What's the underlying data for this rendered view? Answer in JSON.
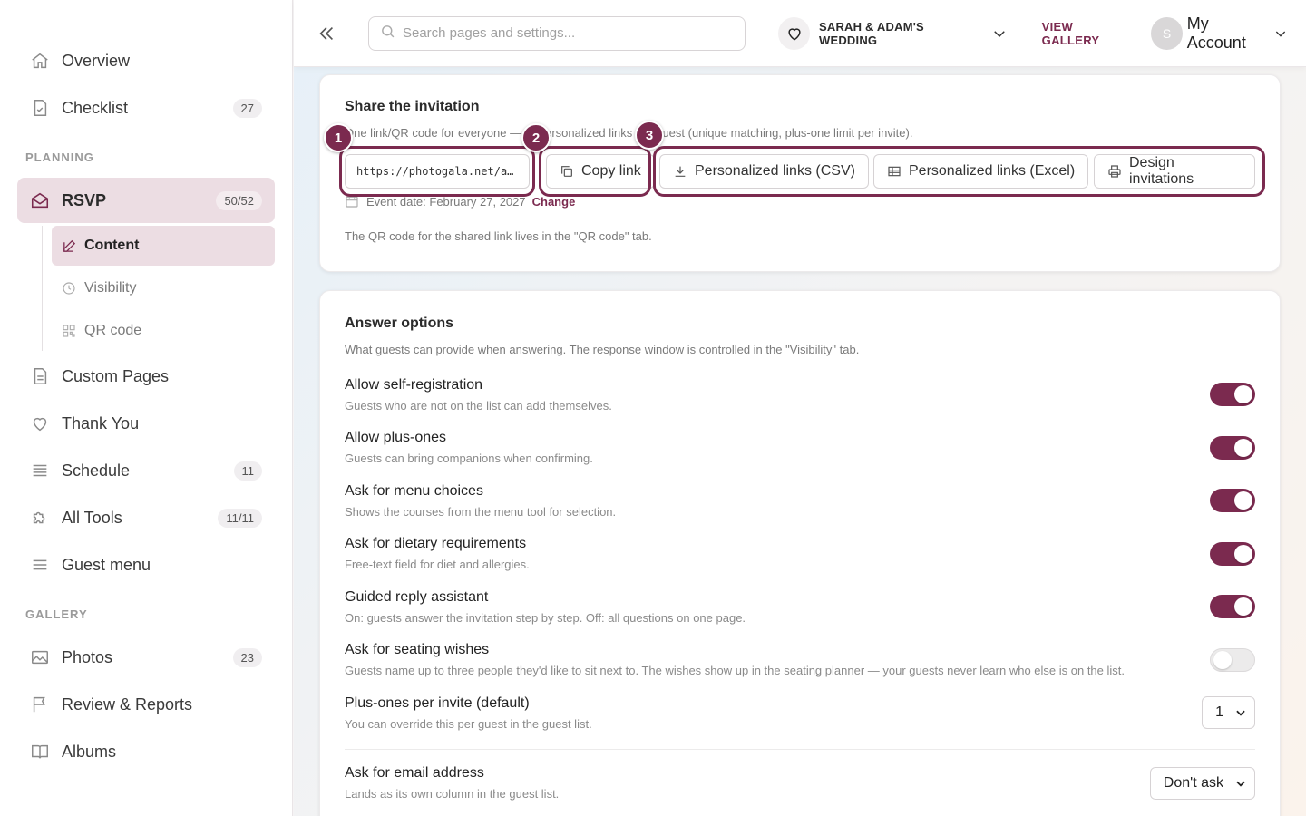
{
  "sidebar": {
    "items_top": [
      {
        "label": "Overview",
        "icon": "home-icon",
        "badge": ""
      },
      {
        "label": "Checklist",
        "icon": "checklist-icon",
        "badge": "27"
      }
    ],
    "planning_title": "PLANNING",
    "rsvp": {
      "label": "RSVP",
      "badge": "50/52"
    },
    "rsvp_sub": [
      {
        "label": "Content"
      },
      {
        "label": "Visibility"
      },
      {
        "label": "QR code"
      }
    ],
    "items_mid": [
      {
        "label": "Custom Pages",
        "badge": ""
      },
      {
        "label": "Thank You",
        "badge": ""
      },
      {
        "label": "Schedule",
        "badge": "11"
      },
      {
        "label": "All Tools",
        "badge": "11/11"
      },
      {
        "label": "Guest menu",
        "badge": ""
      }
    ],
    "gallery_title": "GALLERY",
    "items_gallery": [
      {
        "label": "Photos",
        "badge": "23"
      },
      {
        "label": "Review & Reports",
        "badge": ""
      },
      {
        "label": "Albums",
        "badge": ""
      }
    ]
  },
  "topbar": {
    "search_placeholder": "Search pages and settings...",
    "event_name": "SARAH & ADAM'S WEDDING",
    "view_gallery": "VIEW GALLERY",
    "avatar_initial": "S",
    "account_label": "My Account"
  },
  "share": {
    "title": "Share the invitation",
    "desc": "One link/QR code for everyone — or personalized links per guest (unique matching, plus-one limit per invite).",
    "link": "https://photogala.net/a…",
    "copy_label": "Copy link",
    "csv_label": "Personalized links (CSV)",
    "excel_label": "Personalized links (Excel)",
    "design_label": "Design invitations",
    "steps": [
      "1",
      "2",
      "3"
    ],
    "event_date": "Event date: February 27, 2027",
    "change_label": "Change",
    "qr_note": "The QR code for the shared link lives in the \"QR code\" tab."
  },
  "answers": {
    "title": "Answer options",
    "desc": "What guests can provide when answering. The response window is controlled in the \"Visibility\" tab.",
    "options": [
      {
        "title": "Allow self-registration",
        "desc": "Guests who are not on the list can add themselves.",
        "on": true
      },
      {
        "title": "Allow plus-ones",
        "desc": "Guests can bring companions when confirming.",
        "on": true
      },
      {
        "title": "Ask for menu choices",
        "desc": "Shows the courses from the menu tool for selection.",
        "on": true
      },
      {
        "title": "Ask for dietary requirements",
        "desc": "Free-text field for diet and allergies.",
        "on": true
      },
      {
        "title": "Guided reply assistant",
        "desc": "On: guests answer the invitation step by step. Off: all questions on one page.",
        "on": true
      },
      {
        "title": "Ask for seating wishes",
        "desc": "Guests name up to three people they'd like to sit next to. The wishes show up in the seating planner — your guests never learn who else is on the list.",
        "on": false
      }
    ],
    "plus_ones": {
      "title": "Plus-ones per invite (default)",
      "desc": "You can override this per guest in the guest list.",
      "value": "1"
    },
    "email": {
      "title": "Ask for email address",
      "desc": "Lands as its own column in the guest list.",
      "value": "Don't ask"
    }
  },
  "colors": {
    "accent": "#7b2a4f",
    "active_bg": "#ecdde3"
  }
}
